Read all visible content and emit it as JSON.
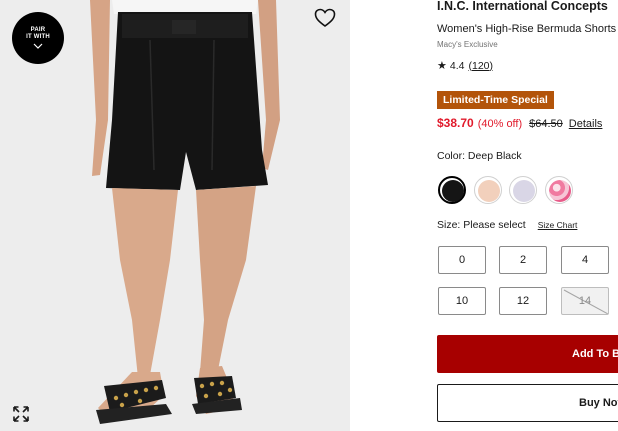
{
  "photo": {
    "pair_badge": {
      "line1": "PAIR",
      "line2": "IT WITH"
    },
    "icons": {
      "favorite": "heart-outline-icon",
      "expand": "expand-arrows-icon",
      "pair": "chevron-down-icon"
    },
    "colors": {
      "background": "#ededed",
      "shorts": "#141414",
      "skin": "#d9a98b",
      "sandals": "#1b1b1b",
      "studs": "#c9a24a"
    }
  },
  "product": {
    "brand": "I.N.C. International Concepts",
    "name": "Women's High-Rise Bermuda Shorts",
    "exclusive": "Macy's Exclusive",
    "rating": {
      "value": "4.4",
      "count": "(120)",
      "icon": "star-icon"
    },
    "promo_badge": "Limited-Time Special",
    "price": {
      "sale": "$38.70",
      "discount": "(40% off)",
      "original": "$64.50",
      "details_link": "Details"
    },
    "color": {
      "label": "Color: Deep Black",
      "swatches": [
        {
          "name": "Deep Black",
          "hex": "#151515",
          "selected": true
        },
        {
          "name": "Blush",
          "hex": "#f2d0bc",
          "selected": false
        },
        {
          "name": "Lilac",
          "hex": "#d9d6e6",
          "selected": false
        },
        {
          "name": "Pink Print",
          "hex": "#f1a5bd",
          "selected": false
        }
      ]
    },
    "size": {
      "label": "Size: Please select",
      "chart_link": "Size Chart",
      "options": [
        {
          "label": "0",
          "available": true
        },
        {
          "label": "2",
          "available": true
        },
        {
          "label": "4",
          "available": true
        },
        {
          "label": "10",
          "available": true
        },
        {
          "label": "12",
          "available": true
        },
        {
          "label": "14",
          "available": false
        }
      ]
    },
    "actions": {
      "add_to_bag": "Add To B",
      "buy_now": "Buy Nov"
    },
    "accent_colors": {
      "sale_red": "#e11a2b",
      "badge_orange": "#b3540a",
      "cta_red": "#a70000"
    }
  }
}
